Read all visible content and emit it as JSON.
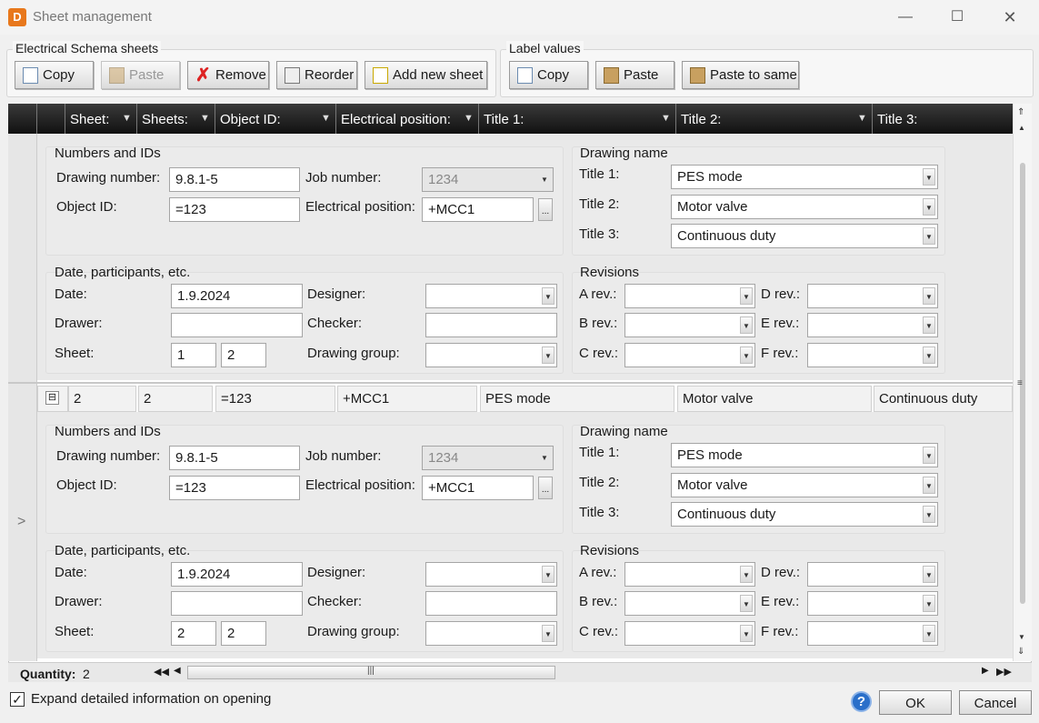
{
  "window": {
    "title": "Sheet management",
    "app_icon": "D"
  },
  "groups": {
    "schema": "Electrical Schema sheets",
    "labels": "Label values"
  },
  "toolbar": {
    "copy": "Copy",
    "paste": "Paste",
    "remove": "Remove",
    "reorder": "Reorder",
    "add": "Add new sheet",
    "lcopy": "Copy",
    "lpaste": "Paste",
    "lpaste_same": "Paste to same"
  },
  "columns": [
    "Sheet:",
    "Sheets:",
    "Object ID:",
    "Electrical position:",
    "Title 1:",
    "Title 2:",
    "Title 3:"
  ],
  "labels": {
    "numbers": "Numbers and IDs",
    "drawing_number": "Drawing number:",
    "job_number": "Job number:",
    "object_id": "Object ID:",
    "electrical_position": "Electrical position:",
    "drawing_name": "Drawing name",
    "title1": "Title 1:",
    "title2": "Title 2:",
    "title3": "Title 3:",
    "date_part": "Date, participants, etc.",
    "date": "Date:",
    "designer": "Designer:",
    "drawer": "Drawer:",
    "checker": "Checker:",
    "sheet": "Sheet:",
    "drawing_group": "Drawing group:",
    "revisions": "Revisions",
    "a_rev": "A rev.:",
    "b_rev": "B rev.:",
    "c_rev": "C rev.:",
    "d_rev": "D rev.:",
    "e_rev": "E rev.:",
    "f_rev": "F rev.:",
    "ellipsis": "..."
  },
  "records": [
    {
      "drawing_number": "9.8.1-5",
      "job_number": "1234",
      "object_id": "=123",
      "electrical_position": "+MCC1",
      "title1": "PES mode",
      "title2": "Motor valve",
      "title3": "Continuous duty",
      "date": "1.9.2024",
      "sheet": "1",
      "sheets": "2"
    },
    {
      "drawing_number": "9.8.1-5",
      "job_number": "1234",
      "object_id": "=123",
      "electrical_position": "+MCC1",
      "title1": "PES mode",
      "title2": "Motor valve",
      "title3": "Continuous duty",
      "date": "1.9.2024",
      "sheet": "2",
      "sheets": "2"
    }
  ],
  "row2": {
    "sheet": "2",
    "sheets": "2",
    "object_id": "=123",
    "electrical_position": "+MCC1",
    "title1": "PES mode",
    "title2": "Motor valve",
    "title3": "Continuous duty",
    "expander": "⊟"
  },
  "status": {
    "quantity_label": "Quantity:",
    "quantity": "2"
  },
  "footer": {
    "expand_label": "Expand detailed information on opening",
    "ok": "OK",
    "cancel": "Cancel",
    "help": "?"
  }
}
